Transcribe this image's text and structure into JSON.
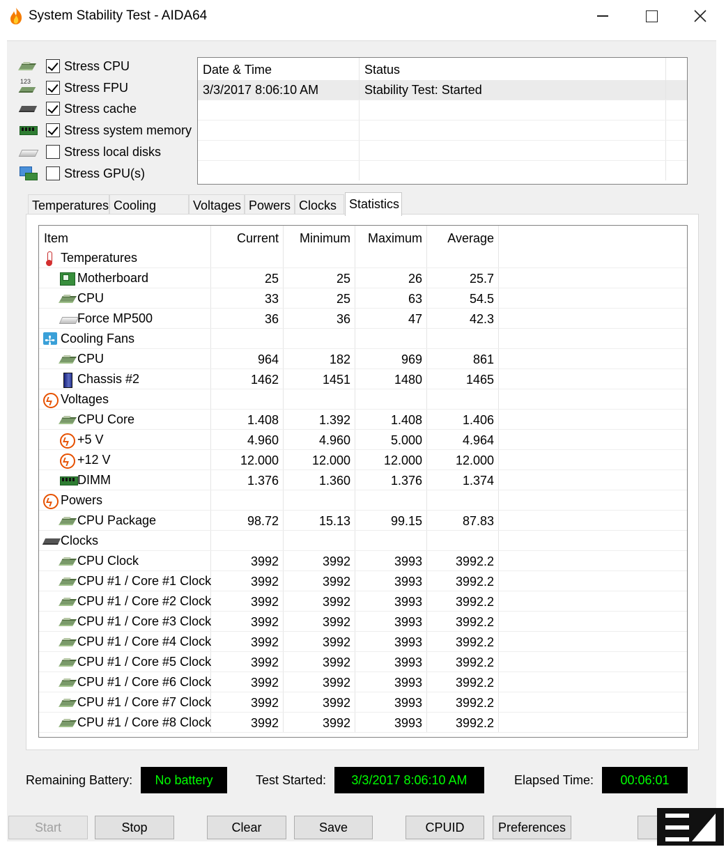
{
  "window": {
    "title": "System Stability Test - AIDA64"
  },
  "stress_options": [
    {
      "label": "Stress CPU",
      "checked": true,
      "icon": "cpu-chip-icon"
    },
    {
      "label": "Stress FPU",
      "checked": true,
      "icon": "fpu-icon"
    },
    {
      "label": "Stress cache",
      "checked": true,
      "icon": "cache-chip-icon"
    },
    {
      "label": "Stress system memory",
      "checked": true,
      "icon": "memory-module-icon"
    },
    {
      "label": "Stress local disks",
      "checked": false,
      "icon": "disk-icon"
    },
    {
      "label": "Stress GPU(s)",
      "checked": false,
      "icon": "gpu-icon"
    }
  ],
  "log": {
    "headers": {
      "datetime": "Date & Time",
      "status": "Status"
    },
    "rows": [
      {
        "datetime": "3/3/2017 8:06:10 AM",
        "status": "Stability Test: Started"
      }
    ]
  },
  "tabs": [
    "Temperatures",
    "Cooling Fans",
    "Voltages",
    "Powers",
    "Clocks",
    "Statistics"
  ],
  "active_tab": "Statistics",
  "stats": {
    "headers": {
      "item": "Item",
      "current": "Current",
      "minimum": "Minimum",
      "maximum": "Maximum",
      "average": "Average"
    },
    "rows": [
      {
        "item": "Temperatures",
        "group": true,
        "icon": "thermometer-icon",
        "current": "",
        "minimum": "",
        "maximum": "",
        "average": ""
      },
      {
        "item": "Motherboard",
        "group": false,
        "icon": "motherboard-icon",
        "current": "25",
        "minimum": "25",
        "maximum": "26",
        "average": "25.7"
      },
      {
        "item": "CPU",
        "group": false,
        "icon": "cpu-chip-icon",
        "current": "33",
        "minimum": "25",
        "maximum": "63",
        "average": "54.5"
      },
      {
        "item": "Force MP500",
        "group": false,
        "icon": "disk-icon",
        "current": "36",
        "minimum": "36",
        "maximum": "47",
        "average": "42.3"
      },
      {
        "item": "Cooling Fans",
        "group": true,
        "icon": "fan-icon",
        "current": "",
        "minimum": "",
        "maximum": "",
        "average": ""
      },
      {
        "item": "CPU",
        "group": false,
        "icon": "cpu-chip-icon",
        "current": "964",
        "minimum": "182",
        "maximum": "969",
        "average": "861"
      },
      {
        "item": "Chassis #2",
        "group": false,
        "icon": "chassis-icon",
        "current": "1462",
        "minimum": "1451",
        "maximum": "1480",
        "average": "1465"
      },
      {
        "item": "Voltages",
        "group": true,
        "icon": "voltage-icon",
        "current": "",
        "minimum": "",
        "maximum": "",
        "average": ""
      },
      {
        "item": "CPU Core",
        "group": false,
        "icon": "cpu-chip-icon",
        "current": "1.408",
        "minimum": "1.392",
        "maximum": "1.408",
        "average": "1.406"
      },
      {
        "item": "+5 V",
        "group": false,
        "icon": "voltage-icon",
        "current": "4.960",
        "minimum": "4.960",
        "maximum": "5.000",
        "average": "4.964"
      },
      {
        "item": "+12 V",
        "group": false,
        "icon": "voltage-icon",
        "current": "12.000",
        "minimum": "12.000",
        "maximum": "12.000",
        "average": "12.000"
      },
      {
        "item": "DIMM",
        "group": false,
        "icon": "memory-module-icon",
        "current": "1.376",
        "minimum": "1.360",
        "maximum": "1.376",
        "average": "1.374"
      },
      {
        "item": "Powers",
        "group": true,
        "icon": "voltage-icon",
        "current": "",
        "minimum": "",
        "maximum": "",
        "average": ""
      },
      {
        "item": "CPU Package",
        "group": false,
        "icon": "cpu-chip-icon",
        "current": "98.72",
        "minimum": "15.13",
        "maximum": "99.15",
        "average": "87.83"
      },
      {
        "item": "Clocks",
        "group": true,
        "icon": "cache-chip-icon",
        "current": "",
        "minimum": "",
        "maximum": "",
        "average": ""
      },
      {
        "item": "CPU Clock",
        "group": false,
        "icon": "cpu-chip-icon",
        "current": "3992",
        "minimum": "3992",
        "maximum": "3993",
        "average": "3992.2"
      },
      {
        "item": "CPU #1 / Core #1 Clock",
        "group": false,
        "icon": "cpu-chip-icon",
        "current": "3992",
        "minimum": "3992",
        "maximum": "3993",
        "average": "3992.2"
      },
      {
        "item": "CPU #1 / Core #2 Clock",
        "group": false,
        "icon": "cpu-chip-icon",
        "current": "3992",
        "minimum": "3992",
        "maximum": "3993",
        "average": "3992.2"
      },
      {
        "item": "CPU #1 / Core #3 Clock",
        "group": false,
        "icon": "cpu-chip-icon",
        "current": "3992",
        "minimum": "3992",
        "maximum": "3993",
        "average": "3992.2"
      },
      {
        "item": "CPU #1 / Core #4 Clock",
        "group": false,
        "icon": "cpu-chip-icon",
        "current": "3992",
        "minimum": "3992",
        "maximum": "3993",
        "average": "3992.2"
      },
      {
        "item": "CPU #1 / Core #5 Clock",
        "group": false,
        "icon": "cpu-chip-icon",
        "current": "3992",
        "minimum": "3992",
        "maximum": "3993",
        "average": "3992.2"
      },
      {
        "item": "CPU #1 / Core #6 Clock",
        "group": false,
        "icon": "cpu-chip-icon",
        "current": "3992",
        "minimum": "3992",
        "maximum": "3993",
        "average": "3992.2"
      },
      {
        "item": "CPU #1 / Core #7 Clock",
        "group": false,
        "icon": "cpu-chip-icon",
        "current": "3992",
        "minimum": "3992",
        "maximum": "3993",
        "average": "3992.2"
      },
      {
        "item": "CPU #1 / Core #8 Clock",
        "group": false,
        "icon": "cpu-chip-icon",
        "current": "3992",
        "minimum": "3992",
        "maximum": "3993",
        "average": "3992.2"
      }
    ]
  },
  "status": {
    "battery_label": "Remaining Battery:",
    "battery_value": "No battery",
    "started_label": "Test Started:",
    "started_value": "3/3/2017 8:06:10 AM",
    "elapsed_label": "Elapsed Time:",
    "elapsed_value": "00:06:01"
  },
  "buttons": {
    "start": {
      "label": "Start",
      "enabled": false
    },
    "stop": {
      "label": "Stop",
      "enabled": true
    },
    "clear": {
      "label": "Clear",
      "enabled": true
    },
    "save": {
      "label": "Save",
      "enabled": true
    },
    "cpuid": {
      "label": "CPUID",
      "enabled": true
    },
    "preferences": {
      "label": "Preferences",
      "enabled": true
    }
  },
  "colors": {
    "status_bg": "#000000",
    "status_text": "#00ff00",
    "window_bg": "#f0f0f0"
  }
}
